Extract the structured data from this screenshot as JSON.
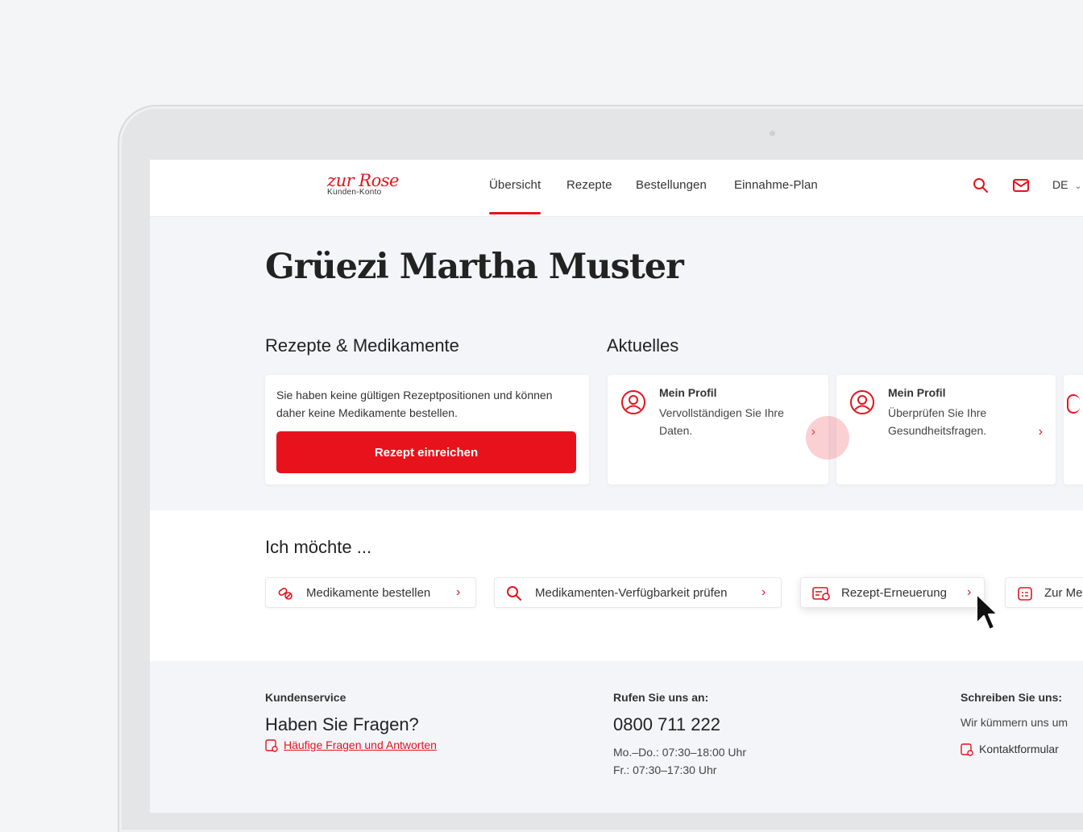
{
  "brand": {
    "logo": "zur Rose",
    "sub": "Kunden-Konto",
    "color": "#e5131d"
  },
  "nav": {
    "items": [
      "Übersicht",
      "Rezepte",
      "Bestellungen",
      "Einnahme-Plan"
    ],
    "active": "Übersicht",
    "lang": "DE"
  },
  "greeting": "Grüezi Martha Muster",
  "prescriptions": {
    "title": "Rezepte & Medikamente",
    "text": "Sie haben keine gültigen Rezeptpositionen und können daher keine Medikamente bestellen.",
    "button": "Rezept einreichen"
  },
  "news": {
    "title": "Aktuelles",
    "items": [
      {
        "title": "Mein Profil",
        "desc": "Vervollständigen Sie Ihre Daten.",
        "icon": "user-circle-icon"
      },
      {
        "title": "Mein Profil",
        "desc": "Überprüfen Sie Ihre Gesundheitsfragen.",
        "icon": "user-circle-icon"
      }
    ]
  },
  "actions": {
    "title": "Ich möchte ...",
    "items": [
      {
        "label": "Medikamente bestellen",
        "icon": "pills-icon"
      },
      {
        "label": "Medikamenten-Verfügbarkeit prüfen",
        "icon": "search-icon"
      },
      {
        "label": "Rezept-Erneuerung",
        "icon": "prescription-renew-icon"
      },
      {
        "label": "Zur Me",
        "icon": "calendar-icon"
      }
    ]
  },
  "footer": {
    "service": {
      "label": "Kundenservice",
      "heading": "Haben Sie Fragen?",
      "link": "Häufige Fragen und Antworten"
    },
    "call": {
      "label": "Rufen Sie uns an:",
      "phone": "0800 711 222",
      "hours1": "Mo.–Do.: 07:30–18:00 Uhr",
      "hours2": "Fr.: 07:30–17:30 Uhr"
    },
    "write": {
      "label": "Schreiben Sie uns:",
      "text": "Wir kümmern uns um",
      "link": "Kontaktformular"
    }
  }
}
